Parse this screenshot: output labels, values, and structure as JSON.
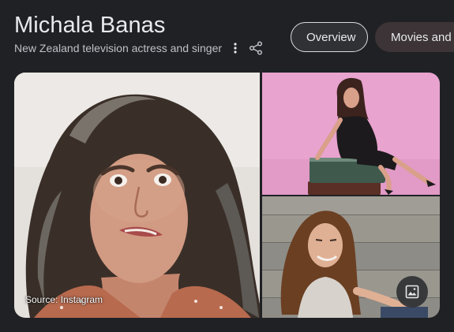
{
  "entity": {
    "name": "Michala Banas",
    "description": "New Zealand television actress and singer"
  },
  "tabs": [
    {
      "label": "Overview",
      "selected": true
    },
    {
      "label": "Movies and s",
      "selected": false
    }
  ],
  "gallery": {
    "source_label": "Source: Instagram"
  },
  "icons": {
    "more": "more-vert-icon",
    "share": "share-icon",
    "images": "image-icon"
  },
  "colors": {
    "background": "#202124",
    "text_primary": "#e8eaed",
    "text_secondary": "#bdc1c6",
    "chip_selected_border": "#dadce0",
    "chip_unselected_bg": "#3c3436",
    "photo_pink_bg": "#e8a3cf"
  }
}
